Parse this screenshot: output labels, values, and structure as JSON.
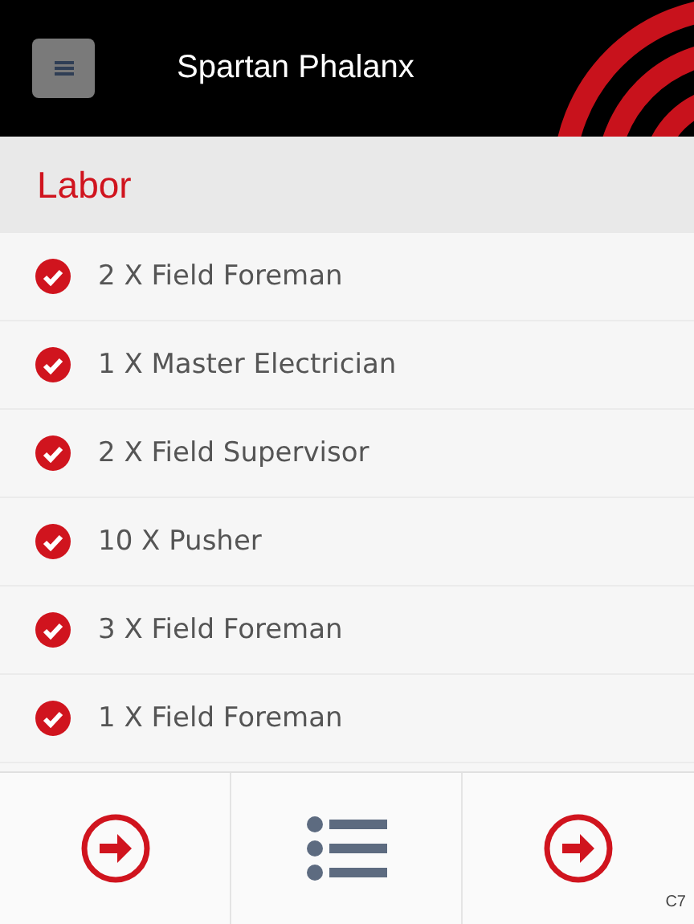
{
  "header": {
    "title": "Spartan Phalanx"
  },
  "section": {
    "title": "Labor"
  },
  "items": [
    {
      "label": "2 X Field Foreman",
      "checked": true
    },
    {
      "label": "1 X Master Electrician",
      "checked": true
    },
    {
      "label": "2 X Field Supervisor",
      "checked": true
    },
    {
      "label": "10 X Pusher",
      "checked": true
    },
    {
      "label": "3 X Field Foreman",
      "checked": true
    },
    {
      "label": "1 X Field Foreman",
      "checked": true
    }
  ],
  "footer": [
    {
      "kind": "arrow"
    },
    {
      "kind": "list"
    },
    {
      "kind": "arrow",
      "corner_label": "C7"
    }
  ]
}
